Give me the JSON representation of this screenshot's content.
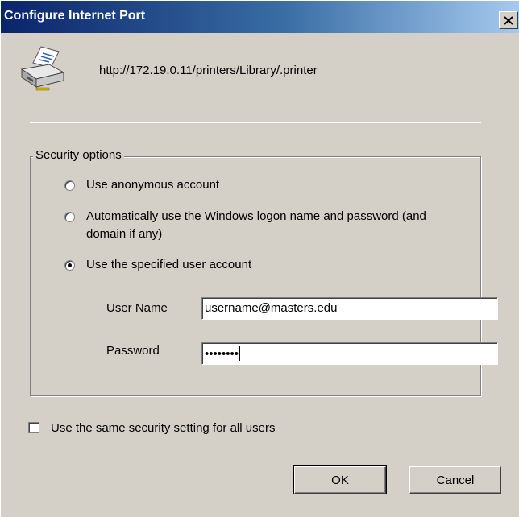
{
  "window": {
    "title": "Configure Internet Port",
    "close_label": "X"
  },
  "header": {
    "icon": "printer-icon",
    "url": "http://172.19.0.11/printers/Library/.printer"
  },
  "security": {
    "legend": "Security options",
    "options": [
      {
        "label": "Use anonymous account",
        "selected": false
      },
      {
        "label_line1": "Automatically use the Windows logon name and password (and",
        "label_line2": "domain if any)",
        "selected": false
      },
      {
        "label": "Use the specified user account",
        "selected": true
      }
    ],
    "username_label": "User Name",
    "username_value": "username@masters.edu",
    "password_label": "Password",
    "password_value": "••••••••"
  },
  "same_setting": {
    "label": "Use the same security setting for all users",
    "checked": false
  },
  "buttons": {
    "ok": "OK",
    "cancel": "Cancel"
  }
}
